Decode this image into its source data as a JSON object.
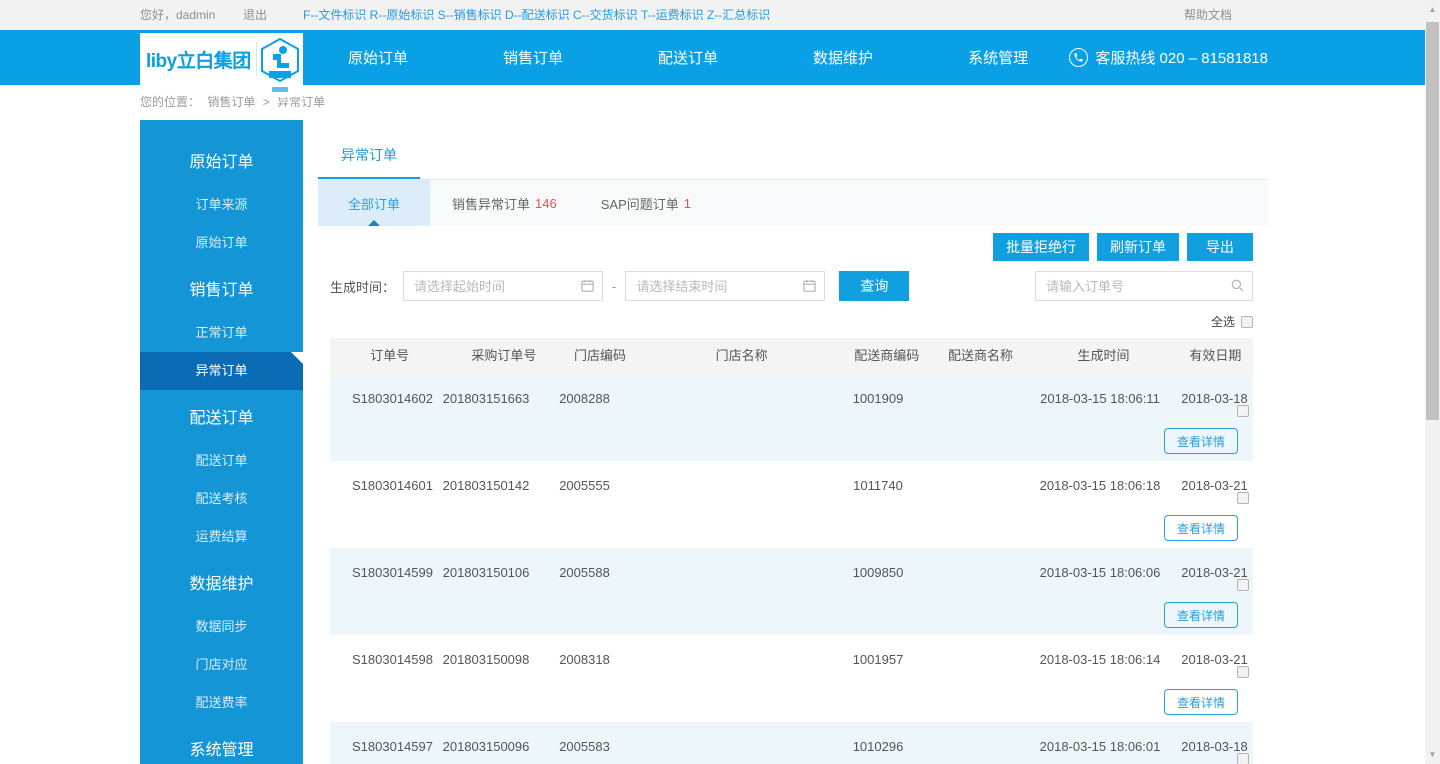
{
  "topbar": {
    "greeting": "您好，dadmin",
    "logout": "退出",
    "legend": "F--文件标识 R--原始标识 S--销售标识 D--配送标识 C--交货标识 T--运费标识 Z--汇总标识",
    "help": "帮助文档"
  },
  "header": {
    "logo_text": "liby立白集团",
    "nav": [
      {
        "label": "原始订单"
      },
      {
        "label": "销售订单"
      },
      {
        "label": "配送订单"
      },
      {
        "label": "数据维护"
      },
      {
        "label": "系统管理"
      }
    ],
    "hotline": "客服热线 020 – 81581818"
  },
  "breadcrumb": {
    "prefix": "您的位置：",
    "parent": "销售订单",
    "separator": ">",
    "current": "异常订单"
  },
  "sidebar": {
    "sections": [
      {
        "title": "原始订单",
        "items": [
          {
            "label": "订单来源"
          },
          {
            "label": "原始订单"
          }
        ]
      },
      {
        "title": "销售订单",
        "items": [
          {
            "label": "正常订单"
          },
          {
            "label": "异常订单",
            "active": true
          }
        ]
      },
      {
        "title": "配送订单",
        "items": [
          {
            "label": "配送订单"
          },
          {
            "label": "配送考核"
          },
          {
            "label": "运费结算"
          }
        ]
      },
      {
        "title": "数据维护",
        "items": [
          {
            "label": "数据同步"
          },
          {
            "label": "门店对应"
          },
          {
            "label": "配送费率"
          }
        ]
      },
      {
        "title": "系统管理",
        "items": []
      }
    ]
  },
  "main": {
    "page_tab": "异常订单",
    "subtabs": [
      {
        "label": "全部订单",
        "count": "",
        "active": true
      },
      {
        "label": "销售异常订单",
        "count": "146",
        "active": false
      },
      {
        "label": "SAP问题订单",
        "count": "1",
        "active": false
      }
    ],
    "actions": {
      "batch_reject": "批量拒绝行",
      "refresh": "刷新订单",
      "export": "导出"
    },
    "filter": {
      "label": "生成时间：",
      "start_placeholder": "请选择起始时间",
      "dash": "-",
      "end_placeholder": "请选择结束时间",
      "query": "查询",
      "search_placeholder": "请输入订单号"
    },
    "select_all": "全选",
    "table": {
      "headers": [
        "订单号",
        "采购订单号",
        "门店编码",
        "门店名称",
        "配送商编码",
        "配送商名称",
        "生成时间",
        "有效日期"
      ],
      "detail_button": "查看详情",
      "store_name_redacted": true,
      "dist_name_redacted": true,
      "rows": [
        {
          "order_no": "S1803014602",
          "purchase_no": "201803151663",
          "store_code": "2008288",
          "dist_code": "1001909",
          "created": "2018-03-15 18:06:11",
          "valid": "2018-03-18"
        },
        {
          "order_no": "S1803014601",
          "purchase_no": "201803150142",
          "store_code": "2005555",
          "dist_code": "1011740",
          "created": "2018-03-15 18:06:18",
          "valid": "2018-03-21"
        },
        {
          "order_no": "S1803014599",
          "purchase_no": "201803150106",
          "store_code": "2005588",
          "dist_code": "1009850",
          "created": "2018-03-15 18:06:06",
          "valid": "2018-03-21"
        },
        {
          "order_no": "S1803014598",
          "purchase_no": "201803150098",
          "store_code": "2008318",
          "dist_code": "1001957",
          "created": "2018-03-15 18:06:14",
          "valid": "2018-03-21"
        },
        {
          "order_no": "S1803014597",
          "purchase_no": "201803150096",
          "store_code": "2005583",
          "dist_code": "1010296",
          "created": "2018-03-15 18:06:01",
          "valid": "2018-03-18"
        }
      ]
    }
  },
  "colors": {
    "header_blue": "#0aa0e6",
    "sidebar_blue": "#1495d6",
    "sidebar_active_blue": "#0b6cb5",
    "accent_blue": "#1a9ed8",
    "subtab_active_bg": "#dcedf9",
    "row_stripe": "#edf6fb",
    "count_red": "#e85250"
  }
}
